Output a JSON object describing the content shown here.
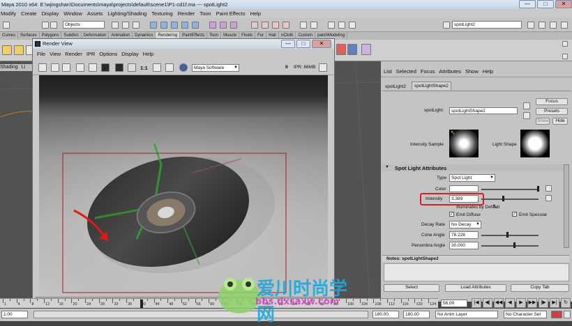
{
  "window": {
    "title": "Maya 2010 x64: E:\\wjingshan\\Documents\\maya\\projects\\default\\scene1\\P1-cd1f.ma   ---   spotLight2",
    "min": "—",
    "max": "□",
    "close": "✕"
  },
  "menubar": [
    "Modify",
    "Create",
    "Display",
    "Window",
    "Assets",
    "Lighting/Shading",
    "Texturing",
    "Render",
    "Toon",
    "Paint Effects",
    "Help"
  ],
  "statusline": {
    "selection_mask": "Objects",
    "selected_object": "spotLight2"
  },
  "shelf_tabs": [
    "Curves",
    "Surfaces",
    "Polygons",
    "Subdivs",
    "Deformation",
    "Animation",
    "Dynamics",
    "Rendering",
    "PaintEffects",
    "Toon",
    "Muscle",
    "Fluids",
    "Fur",
    "Hair",
    "nCloth",
    "Custom",
    "patchModeling"
  ],
  "viewport_menu": {
    "shading": "Shading",
    "lighting": "Li"
  },
  "render_view": {
    "title": "Render View",
    "menu": [
      "File",
      "View",
      "Render",
      "IPR",
      "Options",
      "Display",
      "Help"
    ],
    "ratio": "1:1",
    "renderer": "Maya Software",
    "pause": "II",
    "ipr_mem": "IPR: 68MB"
  },
  "attr_editor": {
    "menu": [
      "List",
      "Selected",
      "Focus",
      "Attributes",
      "Show",
      "Help"
    ],
    "tabs": [
      "spotLight2",
      "spotLightShape2"
    ],
    "node_label": "spotLight:",
    "node_value": "spotLightShape2",
    "buttons": {
      "focus": "Focus",
      "presets": "Presets",
      "show": "Show",
      "hide": "Hide"
    },
    "intensity_sample_label": "Intensity Sample",
    "light_shape_label": "Light Shape",
    "section_title": "Spot Light Attributes",
    "type_label": "Type",
    "type_value": "Spot Light",
    "color_label": "Color",
    "intensity_label": "Intensity",
    "intensity_value": "3.389",
    "illuminates_default": "Illuminates by Default",
    "emit_diffuse": "Emit Diffuse",
    "emit_specular": "Emit Specular",
    "decay_label": "Decay Rate",
    "decay_value": "No Decay",
    "cone_label": "Cone Angle",
    "cone_value": "78.228",
    "penumbra_label": "Penumbra Angle",
    "penumbra_value": "30.000",
    "notes_label": "Notes:  spotLightShape2",
    "bottom_buttons": [
      "Select",
      "Load Attributes",
      "Copy Tab"
    ]
  },
  "timeline": {
    "ticks": [
      "1",
      "",
      "4",
      "",
      "8",
      "",
      "12",
      "",
      "16",
      "",
      "20",
      "",
      "24",
      "",
      "28",
      "",
      "32",
      "",
      "36",
      "",
      "40",
      "",
      "44",
      "",
      "48",
      "",
      "52",
      "",
      "56",
      "",
      "60",
      "",
      "64",
      "",
      "68",
      "",
      "72",
      "",
      "76",
      "",
      "80",
      "",
      "84",
      "",
      "88",
      "",
      "92",
      "",
      "96",
      "",
      "100",
      "",
      "104",
      "",
      "108",
      "",
      "112",
      "",
      "116",
      "",
      "120",
      "",
      "124"
    ],
    "current_frame": "56.00",
    "range_start": "1.00",
    "range_end": "180.00",
    "range_end2": "180.00",
    "anim_layer": "No Anim Layer",
    "char_set": "No Character Set"
  },
  "watermark": {
    "brand": "爱川时尚学网",
    "url": "bbs.dxsaxw.com"
  },
  "colors": {
    "highlight": "#d42020",
    "arrow": "#e01818"
  }
}
